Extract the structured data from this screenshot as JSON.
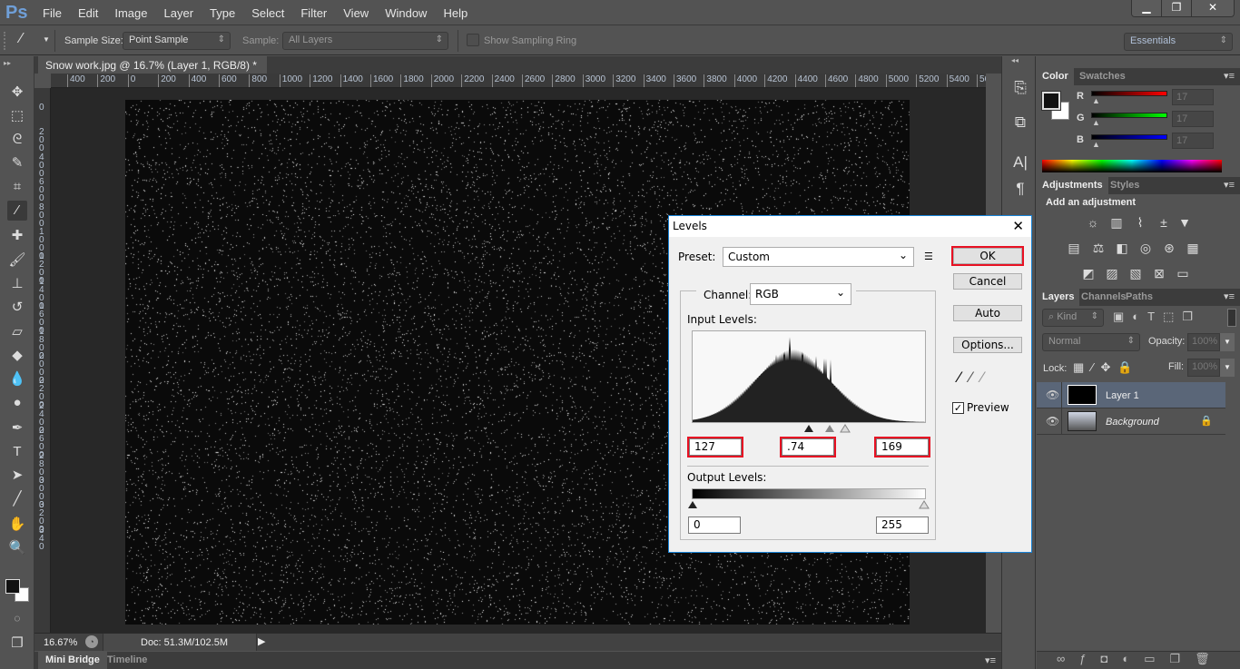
{
  "app": {
    "logo": "Ps",
    "menu": [
      "File",
      "Edit",
      "Image",
      "Layer",
      "Type",
      "Select",
      "Filter",
      "View",
      "Window",
      "Help"
    ],
    "window_controls": [
      "minimize",
      "restore",
      "close"
    ]
  },
  "options_bar": {
    "tool_icon": "eyedropper-icon",
    "sample_size_label": "Sample Size:",
    "sample_size_value": "Point Sample",
    "sample_label": "Sample:",
    "sample_value": "All Layers",
    "show_sampling_ring_label": "Show Sampling Ring",
    "show_sampling_ring_checked": false,
    "workspace": "Essentials"
  },
  "document": {
    "tab_title": "Snow work.jpg @ 16.7% (Layer 1, RGB/8) *",
    "close": "×",
    "h_ruler": [
      "400",
      "200",
      "0",
      "200",
      "400",
      "600",
      "800",
      "1000",
      "1200",
      "1400",
      "1600",
      "1800",
      "2000",
      "2200",
      "2400",
      "2600",
      "2800",
      "3000",
      "3200",
      "3400",
      "3600",
      "3800",
      "4000",
      "4200",
      "4400",
      "4600",
      "4800",
      "5000",
      "5200",
      "5400",
      "56"
    ],
    "v_ruler": [
      "0",
      "200",
      "400",
      "600",
      "800",
      "1000",
      "1200",
      "1400",
      "1600",
      "1800",
      "2000",
      "2200",
      "2400",
      "2600",
      "2800",
      "3000",
      "3200",
      "340"
    ]
  },
  "status": {
    "zoom": "16.67%",
    "doc_info": "Doc: 51.3M/102.5M"
  },
  "bottom_tabs": [
    "Mini Bridge",
    "Timeline"
  ],
  "color_panel": {
    "tabs": [
      "Color",
      "Swatches"
    ],
    "active": "Color",
    "foreground": "#111111",
    "background": "#ffffff",
    "channels": [
      {
        "label": "R",
        "value": "17",
        "color": "#ff0000"
      },
      {
        "label": "G",
        "value": "17",
        "color": "#00ff00"
      },
      {
        "label": "B",
        "value": "17",
        "color": "#0000ff"
      }
    ]
  },
  "adjustments_panel": {
    "tabs": [
      "Adjustments",
      "Styles"
    ],
    "active": "Adjustments",
    "heading": "Add an adjustment"
  },
  "layers_panel": {
    "tabs": [
      "Layers",
      "Channels",
      "Paths"
    ],
    "active": "Layers",
    "filter_kind": "Kind",
    "blend_mode": "Normal",
    "opacity_label": "Opacity:",
    "opacity": "100%",
    "lock_label": "Lock:",
    "fill_label": "Fill:",
    "fill": "100%",
    "layers": [
      {
        "name": "Layer 1",
        "visible": true,
        "selected": true,
        "locked": false
      },
      {
        "name": "Background",
        "visible": true,
        "selected": false,
        "locked": true
      }
    ]
  },
  "levels_dialog": {
    "title": "Levels",
    "close": "✕",
    "preset_label": "Preset:",
    "preset_value": "Custom",
    "channel_label": "Channel:",
    "channel_value": "RGB",
    "input_levels_label": "Input Levels:",
    "input_black": "127",
    "input_gamma": ".74",
    "input_white": "169",
    "output_levels_label": "Output Levels:",
    "output_black": "0",
    "output_white": "255",
    "buttons": {
      "ok": "OK",
      "cancel": "Cancel",
      "auto": "Auto",
      "options": "Options..."
    },
    "preview_label": "Preview",
    "preview_checked": true,
    "highlight_color": "#e81123"
  }
}
